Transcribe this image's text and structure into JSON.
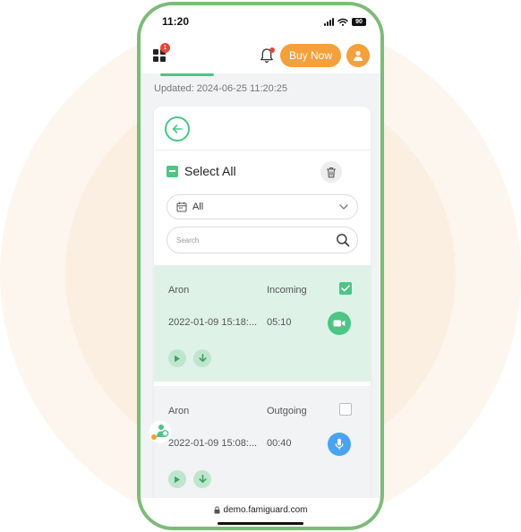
{
  "status_bar": {
    "time": "11:20",
    "battery": "90"
  },
  "header": {
    "notification_count": "1",
    "buy_now_label": "Buy Now"
  },
  "updated": "Updated: 2024-06-25 11:20:25",
  "card": {
    "select_all_label": "Select All",
    "filter_value": "All",
    "search_placeholder": "Search"
  },
  "records": [
    {
      "name": "Aron",
      "direction": "Incoming",
      "datetime": "2022-01-09 15:18:...",
      "duration": "05:10",
      "type": "video",
      "checked": true
    },
    {
      "name": "Aron",
      "direction": "Outgoing",
      "datetime": "2022-01-09 15:08:...",
      "duration": "00:40",
      "type": "audio",
      "checked": false
    }
  ],
  "browser": {
    "url": "demo.famiguard.com"
  },
  "colors": {
    "accent_green": "#4cc585",
    "orange": "#f5a03a",
    "video_green": "#4cc585",
    "audio_blue": "#4aa3f0",
    "badge_red": "#e8453c"
  },
  "icons": [
    "grid-icon",
    "bell-icon",
    "user-icon",
    "arrow-left-icon",
    "trash-icon",
    "calendar-icon",
    "chevron-down-icon",
    "search-icon",
    "checkmark-icon",
    "video-icon",
    "microphone-icon",
    "play-icon",
    "download-icon",
    "lock-icon"
  ]
}
